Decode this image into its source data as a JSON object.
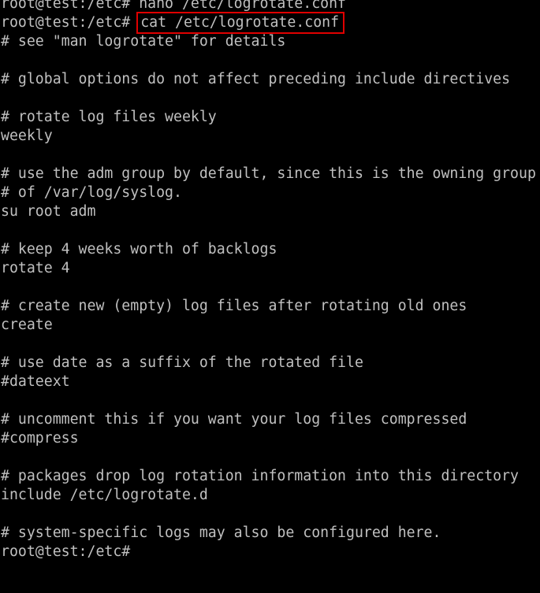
{
  "terminal": {
    "background_color": "#000000",
    "text_color": "#c0c0c0",
    "highlight_color": "#e00000",
    "previous_command": {
      "prompt": "root@test:/etc# ",
      "command": "nano /etc/logrotate.conf"
    },
    "current_command": {
      "prompt": "root@test:/etc# ",
      "command": "cat /etc/logrotate.conf"
    },
    "output": [
      "# see \"man logrotate\" for details",
      "",
      "# global options do not affect preceding include directives",
      "",
      "# rotate log files weekly",
      "weekly",
      "",
      "# use the adm group by default, since this is the owning group",
      "# of /var/log/syslog.",
      "su root adm",
      "",
      "# keep 4 weeks worth of backlogs",
      "rotate 4",
      "",
      "# create new (empty) log files after rotating old ones",
      "create",
      "",
      "# use date as a suffix of the rotated file",
      "#dateext",
      "",
      "# uncomment this if you want your log files compressed",
      "#compress",
      "",
      "# packages drop log rotation information into this directory",
      "include /etc/logrotate.d",
      "",
      "# system-specific logs may also be configured here."
    ],
    "final_prompt": "root@test:/etc# "
  }
}
